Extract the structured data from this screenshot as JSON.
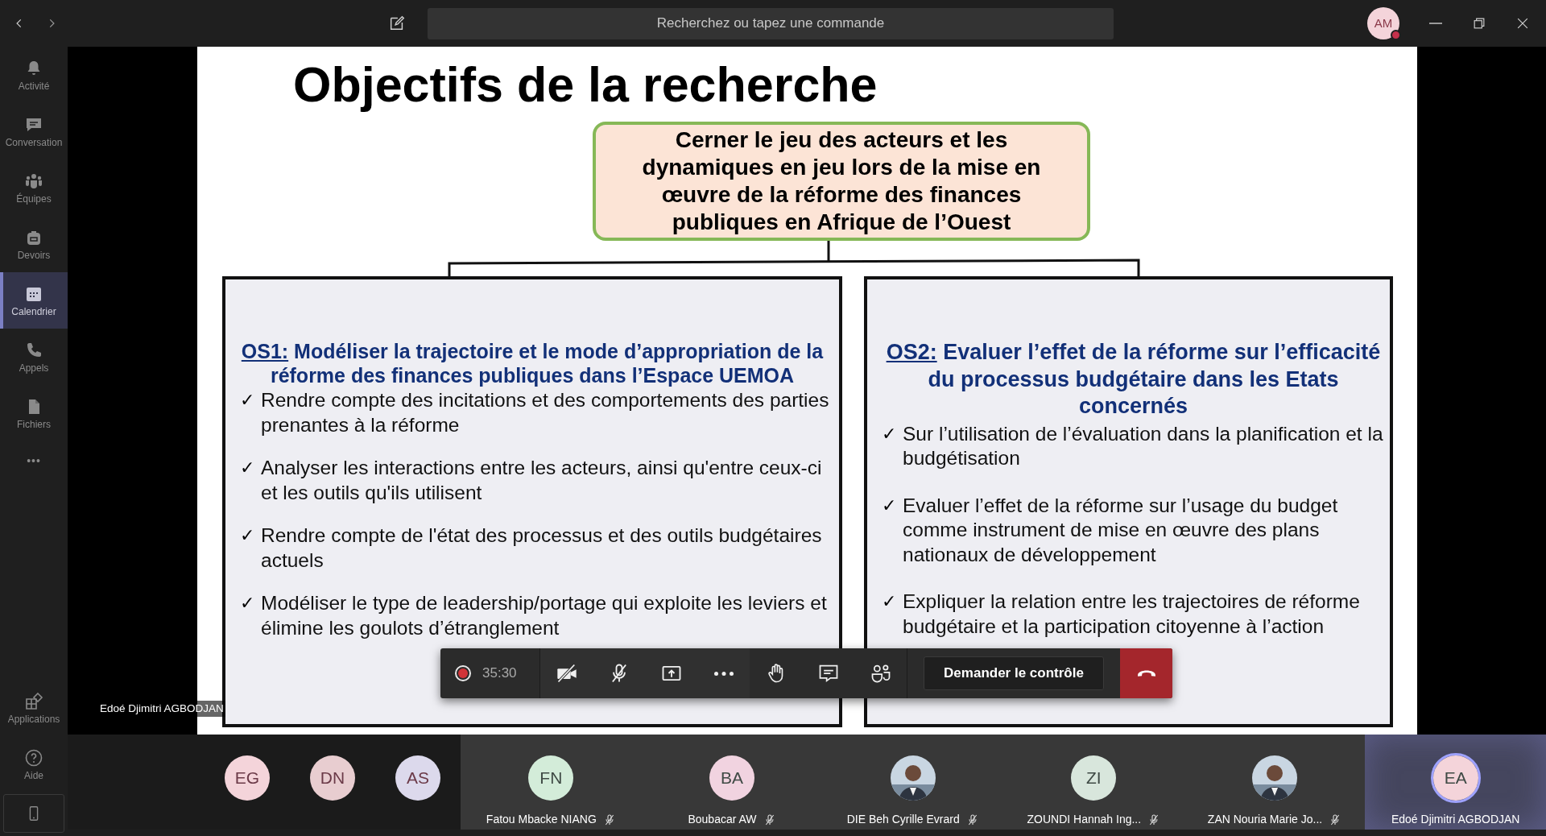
{
  "top_bar": {
    "search_placeholder": "Recherchez ou tapez une commande",
    "user_initials": "AM",
    "busy": true
  },
  "sidebar": {
    "items": [
      {
        "label": "Activité",
        "selected": false
      },
      {
        "label": "Conversation",
        "selected": false
      },
      {
        "label": "Équipes",
        "selected": false
      },
      {
        "label": "Devoirs",
        "selected": false
      },
      {
        "label": "Calendrier",
        "selected": true
      },
      {
        "label": "Appels",
        "selected": false
      },
      {
        "label": "Fichiers",
        "selected": false
      }
    ],
    "more": "•••",
    "bottom_items": [
      {
        "label": "Applications",
        "selected": false
      },
      {
        "label": "Aide",
        "selected": false
      }
    ]
  },
  "slide": {
    "title": "Objectifs de la recherche",
    "main_objective": "Cerner le jeu des acteurs et les dynamiques en jeu lors de la mise en œuvre de la réforme des finances publiques en Afrique de l’Ouest",
    "objectives": [
      {
        "code": "OS1:",
        "heading": "Modéliser la trajectoire et le mode d’appropriation de la réforme des finances publiques dans l’Espace UEMOA",
        "bullets": [
          {
            "mark": "✓",
            "text": "Rendre compte des incitations et des comportements des parties prenantes à la réforme"
          },
          {
            "mark": "✓",
            "text": "Analyser les interactions entre les acteurs, ainsi qu'entre ceux-ci et les outils qu'ils utilisent"
          },
          {
            "mark": "✓",
            "text": "Rendre compte de l'état des processus et des outils budgétaires actuels"
          },
          {
            "mark": "✓",
            "text": "Modéliser le type de leadership/portage qui exploite les leviers et élimine les goulots d’étranglement"
          }
        ]
      },
      {
        "code": "OS2:",
        "heading": "Evaluer l’effet de la réforme sur l’efficacité du processus budgétaire dans les Etats concernés",
        "bullets": [
          {
            "mark": "✓",
            "text": "Sur l’utilisation de l’évaluation dans la planification et la budgétisation"
          },
          {
            "mark": "✓",
            "text": "Evaluer l’effet de la réforme sur l’usage du budget comme instrument de mise en œuvre des plans nationaux de développement"
          },
          {
            "mark": "✓",
            "text": "Expliquer la relation entre les trajectoires de réforme budgétaire et la participation citoyenne à l’action"
          }
        ]
      }
    ]
  },
  "presenter_label": "Edoé Djimitri AGBODJAN",
  "call_controls": {
    "recording": true,
    "elapsed": "35:30",
    "camera_on": false,
    "mic_on": false,
    "control_button": "Demander le contrôle"
  },
  "overflow_avatars": [
    {
      "initials": "EG",
      "color": "#f4d4da"
    },
    {
      "initials": "DN",
      "color": "#e8cdd0"
    },
    {
      "initials": "AS",
      "color": "#dcd9ec"
    }
  ],
  "participants": [
    {
      "kind": "avatar",
      "initials": "FN",
      "color": "#d3ecd9",
      "name": "Fatou Mbacke NIANG",
      "muted": true,
      "speaking": false
    },
    {
      "kind": "avatar",
      "initials": "BA",
      "color": "#f1d3e0",
      "name": "Boubacar AW",
      "muted": true,
      "speaking": false
    },
    {
      "name": "DIE Beh Cyrille Evrard",
      "muted": true,
      "speaking": false
    },
    {
      "kind": "avatar",
      "initials": "ZI",
      "color": "#d8e6dc",
      "name": "ZOUNDI Hannah Ing...",
      "muted": true,
      "speaking": false
    },
    {
      "name": "ZAN Nouria Marie Jo...",
      "muted": true,
      "speaking": false
    },
    {
      "kind": "avatar",
      "initials": "EA",
      "color": "#f4d4da",
      "name": "Edoé Djimitri AGBODJAN",
      "muted": false,
      "speaking": true
    }
  ]
}
